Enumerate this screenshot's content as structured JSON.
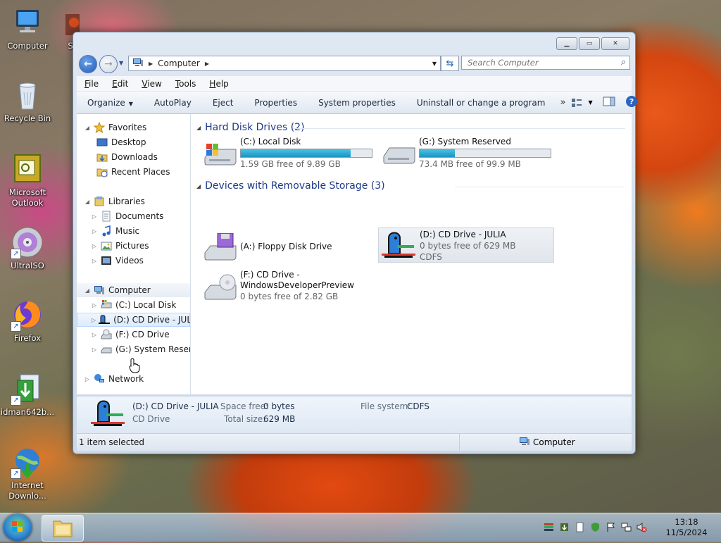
{
  "desktop": {
    "icons": [
      {
        "label": "Computer"
      },
      {
        "label": "Sp"
      },
      {
        "label": "Recycle Bin"
      },
      {
        "label_line1": "Microsoft",
        "label_line2": "Outlook"
      },
      {
        "label": "UltraISO"
      },
      {
        "label": "Firefox"
      },
      {
        "label": "idman642b..."
      },
      {
        "label_line1": "Internet",
        "label_line2": "Downlo..."
      }
    ]
  },
  "window": {
    "address": {
      "root_label": "Computer"
    },
    "search": {
      "placeholder": "Search Computer"
    },
    "menu": [
      "File",
      "Edit",
      "View",
      "Tools",
      "Help"
    ],
    "commands": [
      "Organize",
      "AutoPlay",
      "Eject",
      "Properties",
      "System properties",
      "Uninstall or change a program"
    ],
    "nav": {
      "favorites": "Favorites",
      "desktop": "Desktop",
      "downloads": "Downloads",
      "recent": "Recent Places",
      "libraries": "Libraries",
      "documents": "Documents",
      "music": "Music",
      "pictures": "Pictures",
      "videos": "Videos",
      "computer": "Computer",
      "c_drive": "(C:) Local Disk",
      "d_drive": "(D:) CD Drive - JULIA",
      "f_drive": "(F:) CD Drive",
      "g_drive": "(G:) System Reserved",
      "network": "Network"
    },
    "groups": {
      "hdd": "Hard Disk Drives (2)",
      "removable": "Devices with Removable Storage (3)"
    },
    "drives": {
      "c": {
        "name": "(C:) Local Disk",
        "free": "1.59 GB free of 9.89 GB",
        "used_fraction": 0.84
      },
      "g": {
        "name": "(G:) System Reserved",
        "free": "73.4 MB free of 99.9 MB",
        "used_fraction": 0.27
      },
      "a": {
        "name": "(A:) Floppy Disk Drive"
      },
      "d": {
        "name": "(D:) CD Drive - JULIA",
        "free": "0 bytes free of 629 MB",
        "fs": "CDFS"
      },
      "f": {
        "name_line1": "(F:) CD Drive -",
        "name_line2": "WindowsDeveloperPreview",
        "free": "0 bytes free of 2.82 GB"
      }
    },
    "details": {
      "name": "(D:) CD Drive - JULIA",
      "type": "CD Drive",
      "space_free_label": "Space free:",
      "space_free": "0 bytes",
      "total_size_label": "Total size:",
      "total_size": "629 MB",
      "fs_label": "File system:",
      "fs": "CDFS"
    },
    "status": {
      "left": "1 item selected",
      "right": "Computer"
    }
  },
  "taskbar": {
    "time": "13:18",
    "date": "11/5/2024"
  }
}
